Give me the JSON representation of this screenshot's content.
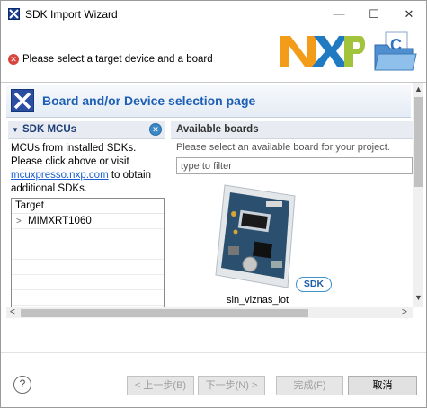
{
  "window": {
    "title": "SDK Import Wizard",
    "controls": {
      "minimize": "—",
      "maximize": "☐",
      "close": "✕"
    }
  },
  "header": {
    "error_message": "Please select a target device and a board",
    "logo_text": "NXP"
  },
  "page": {
    "title": "Board and/or Device selection page"
  },
  "left_panel": {
    "title": "SDK MCUs",
    "text_before": "MCUs from installed SDKs. Please click above or visit ",
    "link": "mcuxpresso.nxp.com",
    "text_after": " to obtain additional SDKs.",
    "table_header": "Target",
    "rows": [
      "MIMXRT1060"
    ]
  },
  "right_panel": {
    "title": "Available boards",
    "hint": "Please select an available board for your project.",
    "filter_placeholder": "type to filter",
    "board_name": "sln_viznas_iot",
    "badge": "SDK"
  },
  "footer": {
    "help": "?",
    "back": "< 上一步(B)",
    "next": "下一步(N) >",
    "finish": "完成(F)",
    "cancel": "取消"
  },
  "colors": {
    "accent": "#1c5fb6",
    "error": "#d9453c",
    "logo_orange": "#f39c1a",
    "logo_blue": "#1f7ac2",
    "logo_green": "#a2c33c"
  }
}
